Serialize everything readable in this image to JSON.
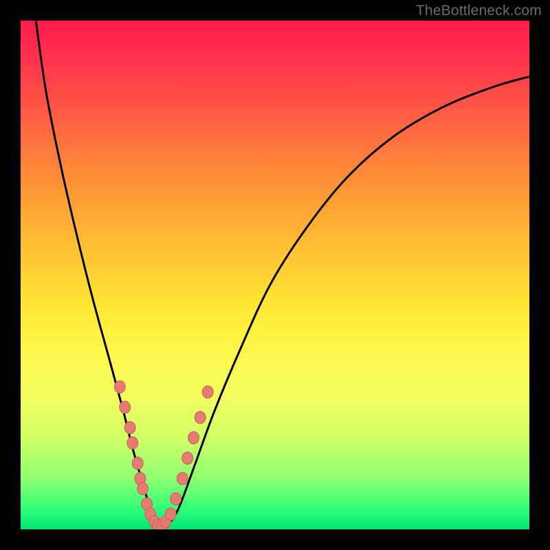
{
  "watermark": "TheBottleneck.com",
  "colors": {
    "frame": "#000000",
    "marker_fill": "#e57b73",
    "marker_stroke": "#c95e58",
    "curve": "#000000",
    "gradient_top": "#ff1a4d",
    "gradient_bottom": "#00e676"
  },
  "chart_data": {
    "type": "line",
    "title": "",
    "xlabel": "",
    "ylabel": "",
    "xlim": [
      0,
      100
    ],
    "ylim": [
      0,
      100
    ],
    "grid": false,
    "legend": false,
    "notes": "Single V-shaped bottleneck curve on a red→green vertical gradient. Salmon dot markers cluster along the lower portion of both curve arms near the trough. Axes have no numeric tick labels, so values below are pixel-space estimates mapped to a 0–100 range.",
    "series": [
      {
        "name": "bottleneck-curve",
        "x": [
          3,
          5,
          8,
          11,
          14,
          17,
          20,
          22,
          24,
          25.5,
          26.5,
          27.5,
          29,
          31,
          34,
          38,
          43,
          49,
          56,
          64,
          73,
          83,
          93,
          100
        ],
        "y": [
          100,
          86,
          71,
          58,
          46,
          35,
          24,
          16,
          9,
          4,
          1,
          0.5,
          1,
          4,
          12,
          23,
          35,
          48,
          59,
          69,
          77,
          83,
          87,
          89
        ]
      }
    ],
    "markers": [
      {
        "x": 19.5,
        "y": 28
      },
      {
        "x": 20.5,
        "y": 24
      },
      {
        "x": 21.5,
        "y": 20
      },
      {
        "x": 22.0,
        "y": 17
      },
      {
        "x": 23.0,
        "y": 13
      },
      {
        "x": 23.5,
        "y": 10
      },
      {
        "x": 24.0,
        "y": 8
      },
      {
        "x": 24.8,
        "y": 5
      },
      {
        "x": 25.5,
        "y": 3
      },
      {
        "x": 26.3,
        "y": 1.5
      },
      {
        "x": 27.0,
        "y": 0.8
      },
      {
        "x": 27.8,
        "y": 0.8
      },
      {
        "x": 28.5,
        "y": 1.5
      },
      {
        "x": 29.5,
        "y": 3
      },
      {
        "x": 30.5,
        "y": 6
      },
      {
        "x": 31.8,
        "y": 10
      },
      {
        "x": 32.8,
        "y": 14
      },
      {
        "x": 34.0,
        "y": 18
      },
      {
        "x": 35.3,
        "y": 22
      },
      {
        "x": 36.8,
        "y": 27
      }
    ]
  }
}
